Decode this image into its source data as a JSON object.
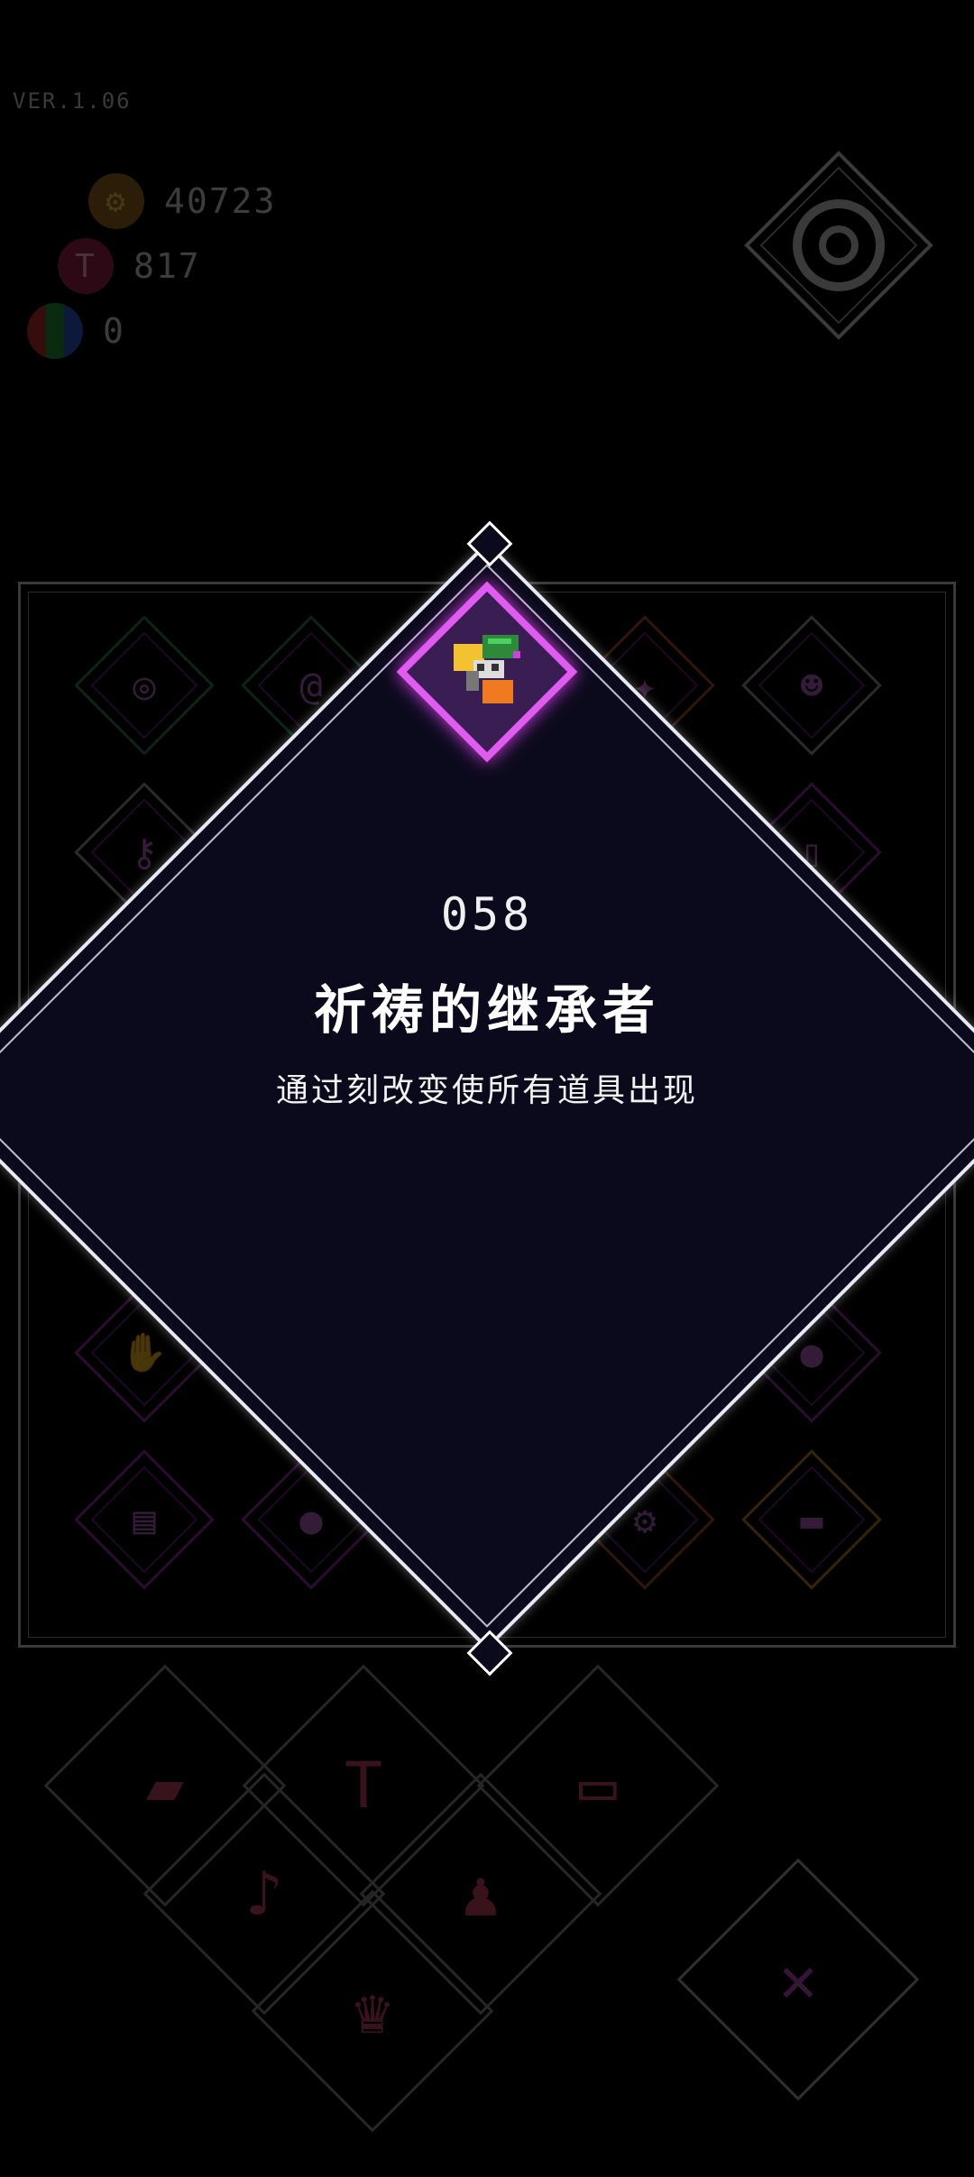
{
  "version": "VER.1.06",
  "currencies": [
    {
      "icon": "gear-icon",
      "value": "40723"
    },
    {
      "icon": "ticket-icon",
      "value": "817"
    },
    {
      "icon": "cube-icon",
      "value": "0"
    }
  ],
  "achievement": {
    "number": "058",
    "name": "祈祷的继承者",
    "description": "通过刻改变使所有道具出现"
  },
  "colors": {
    "modal_bg": "#0b0a1c",
    "badge_border": "#e05bf0",
    "panel_border": "#cfcfcf"
  }
}
